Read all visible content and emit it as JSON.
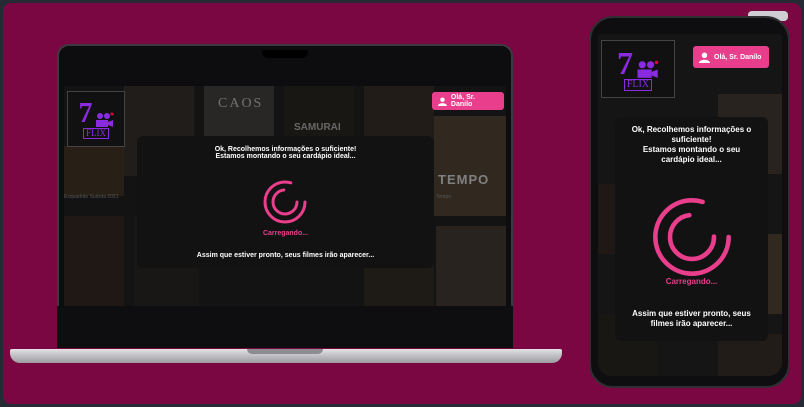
{
  "brand": {
    "logo_number": "7",
    "logo_word": "FLIX"
  },
  "greeting": "Olá, Sr. Danilo",
  "laptop": {
    "modal_title_line1": "Ok, Recolhemos informações o suficiente!",
    "modal_title_line2": "Estamos montando o seu cardápio ideal...",
    "loading_label": "Carregando...",
    "footer": "Assim que estiver pronto, seus filmes irão aparecer...",
    "poster_titles": [
      "CAOS",
      "SAMURAI",
      "TEMPO"
    ],
    "row_label_1": "Esquadrão Suicida 2021",
    "row_label_2": "Tempo"
  },
  "phone": {
    "modal_title_line1": "Ok, Recolhemos informações o",
    "modal_title_line2": "suficiente!",
    "modal_title_line3": "Estamos montando o seu",
    "modal_title_line4": "cardápio ideal...",
    "loading_label": "Carregando...",
    "footer_line1": "Assim que estiver pronto, seus",
    "footer_line2": "filmes irão aparecer..."
  },
  "colors": {
    "background": "#7a0742",
    "accent": "#e83e8c",
    "logo": "#8a2be2"
  }
}
